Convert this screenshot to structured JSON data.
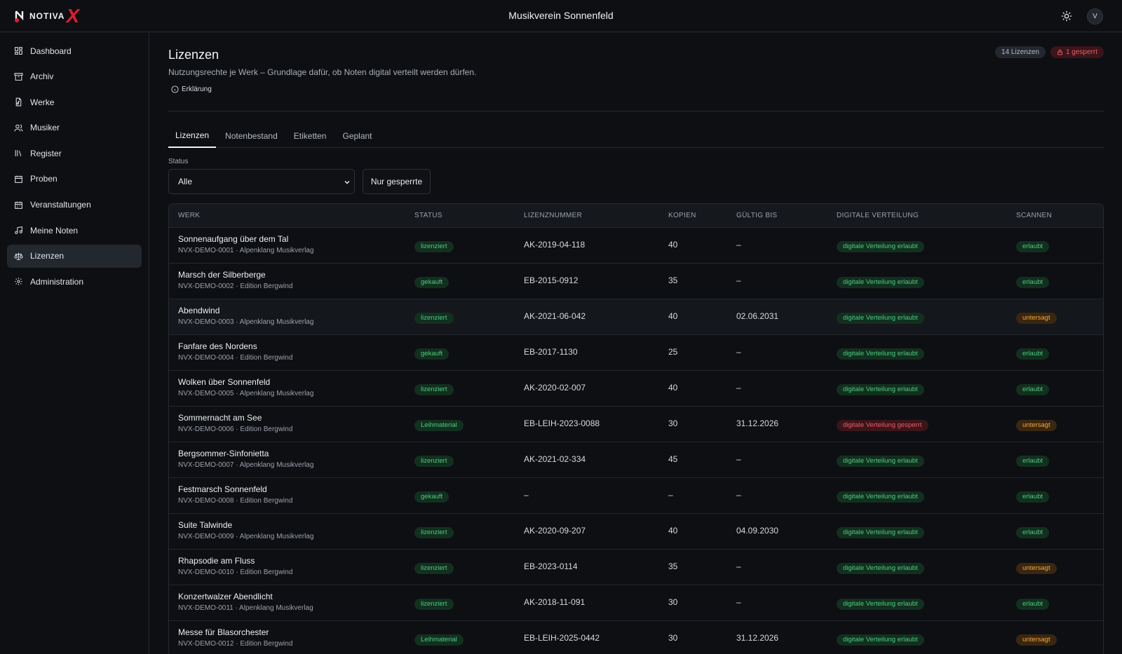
{
  "app": {
    "logo_text": "NOTIVA",
    "logo_mark": "X",
    "title": "Musikverein Sonnenfeld",
    "avatar": "V"
  },
  "sidebar": {
    "items": [
      {
        "label": "Dashboard",
        "icon": "dashboard-icon"
      },
      {
        "label": "Archiv",
        "icon": "archive-icon"
      },
      {
        "label": "Werke",
        "icon": "works-icon"
      },
      {
        "label": "Musiker",
        "icon": "users-icon"
      },
      {
        "label": "Register",
        "icon": "library-icon"
      },
      {
        "label": "Proben",
        "icon": "calendar-icon"
      },
      {
        "label": "Veranstaltungen",
        "icon": "calendar-event-icon"
      },
      {
        "label": "Meine Noten",
        "icon": "music-note-icon"
      },
      {
        "label": "Lizenzen",
        "icon": "scale-icon",
        "active": true
      },
      {
        "label": "Administration",
        "icon": "gear-icon"
      }
    ]
  },
  "page": {
    "title": "Lizenzen",
    "subtitle": "Nutzungsrechte je Werk – Grundlage dafür, ob Noten digital verteilt werden dürfen.",
    "explain_label": "Erklärung",
    "badge_count": "14 Lizenzen",
    "badge_locked": "1 gesperrt"
  },
  "tabs": [
    {
      "label": "Lizenzen",
      "active": true
    },
    {
      "label": "Notenbestand"
    },
    {
      "label": "Etiketten"
    },
    {
      "label": "Geplant"
    }
  ],
  "filters": {
    "status_label": "Status",
    "status_value": "Alle",
    "locked_button": "Nur gesperrte"
  },
  "table": {
    "headers": [
      "WERK",
      "STATUS",
      "LIZENZNUMMER",
      "KOPIEN",
      "GÜLTIG BIS",
      "DIGITALE VERTEILUNG",
      "SCANNEN"
    ],
    "rows": [
      {
        "title": "Sonnenaufgang über dem Tal",
        "sub": "NVX-DEMO-0001 · Alpenklang Musikverlag",
        "status": "lizenziert",
        "number": "AK-2019-04-118",
        "copies": "40",
        "valid": "–",
        "dist": "digitale Verteilung erlaubt",
        "dist_color": "green",
        "scan": "erlaubt",
        "scan_color": "green"
      },
      {
        "title": "Marsch der Silberberge",
        "sub": "NVX-DEMO-0002 · Edition Bergwind",
        "status": "gekauft",
        "number": "EB-2015-0912",
        "copies": "35",
        "valid": "–",
        "dist": "digitale Verteilung erlaubt",
        "dist_color": "green",
        "scan": "erlaubt",
        "scan_color": "green"
      },
      {
        "title": "Abendwind",
        "sub": "NVX-DEMO-0003 · Alpenklang Musikverlag",
        "status": "lizenziert",
        "number": "AK-2021-06-042",
        "copies": "40",
        "valid": "02.06.2031",
        "dist": "digitale Verteilung erlaubt",
        "dist_color": "green",
        "scan": "untersagt",
        "scan_color": "amber",
        "highlight": true
      },
      {
        "title": "Fanfare des Nordens",
        "sub": "NVX-DEMO-0004 · Edition Bergwind",
        "status": "gekauft",
        "number": "EB-2017-1130",
        "copies": "25",
        "valid": "–",
        "dist": "digitale Verteilung erlaubt",
        "dist_color": "green",
        "scan": "erlaubt",
        "scan_color": "green"
      },
      {
        "title": "Wolken über Sonnenfeld",
        "sub": "NVX-DEMO-0005 · Alpenklang Musikverlag",
        "status": "lizenziert",
        "number": "AK-2020-02-007",
        "copies": "40",
        "valid": "–",
        "dist": "digitale Verteilung erlaubt",
        "dist_color": "green",
        "scan": "erlaubt",
        "scan_color": "green"
      },
      {
        "title": "Sommernacht am See",
        "sub": "NVX-DEMO-0006 · Edition Bergwind",
        "status": "Leihmaterial",
        "number": "EB-LEIH-2023-0088",
        "copies": "30",
        "valid": "31.12.2026",
        "dist": "digitale Verteilung gesperrt",
        "dist_color": "red",
        "scan": "untersagt",
        "scan_color": "amber"
      },
      {
        "title": "Bergsommer-Sinfonietta",
        "sub": "NVX-DEMO-0007 · Alpenklang Musikverlag",
        "status": "lizenziert",
        "number": "AK-2021-02-334",
        "copies": "45",
        "valid": "–",
        "dist": "digitale Verteilung erlaubt",
        "dist_color": "green",
        "scan": "erlaubt",
        "scan_color": "green"
      },
      {
        "title": "Festmarsch Sonnenfeld",
        "sub": "NVX-DEMO-0008 · Edition Bergwind",
        "status": "gekauft",
        "number": "–",
        "copies": "–",
        "valid": "–",
        "dist": "digitale Verteilung erlaubt",
        "dist_color": "green",
        "scan": "erlaubt",
        "scan_color": "green"
      },
      {
        "title": "Suite Talwinde",
        "sub": "NVX-DEMO-0009 · Alpenklang Musikverlag",
        "status": "lizenziert",
        "number": "AK-2020-09-207",
        "copies": "40",
        "valid": "04.09.2030",
        "dist": "digitale Verteilung erlaubt",
        "dist_color": "green",
        "scan": "erlaubt",
        "scan_color": "green"
      },
      {
        "title": "Rhapsodie am Fluss",
        "sub": "NVX-DEMO-0010 · Edition Bergwind",
        "status": "lizenziert",
        "number": "EB-2023-0114",
        "copies": "35",
        "valid": "–",
        "dist": "digitale Verteilung erlaubt",
        "dist_color": "green",
        "scan": "untersagt",
        "scan_color": "amber"
      },
      {
        "title": "Konzertwalzer Abendlicht",
        "sub": "NVX-DEMO-0011 · Alpenklang Musikverlag",
        "status": "lizenziert",
        "number": "AK-2018-11-091",
        "copies": "30",
        "valid": "–",
        "dist": "digitale Verteilung erlaubt",
        "dist_color": "green",
        "scan": "erlaubt",
        "scan_color": "green"
      },
      {
        "title": "Messe für Blasorchester",
        "sub": "NVX-DEMO-0012 · Edition Bergwind",
        "status": "Leihmaterial",
        "number": "EB-LEIH-2025-0442",
        "copies": "30",
        "valid": "31.12.2026",
        "dist": "digitale Verteilung erlaubt",
        "dist_color": "green",
        "scan": "untersagt",
        "scan_color": "amber"
      }
    ]
  },
  "colors": {
    "accent_red": "#e21b2e",
    "status_green": "#4fca7f",
    "status_red": "#f05a66",
    "status_amber": "#f2a641"
  }
}
